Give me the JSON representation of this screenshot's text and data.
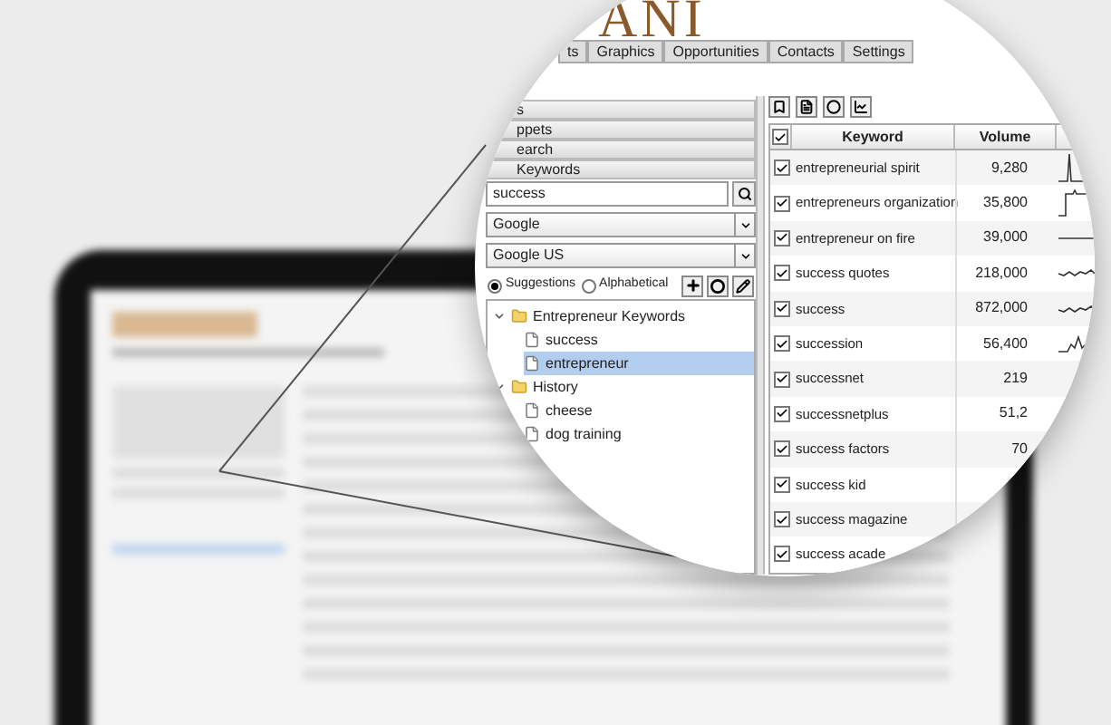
{
  "app": {
    "logo": "ANI",
    "tabs": [
      {
        "label": "ts",
        "selected": false
      },
      {
        "label": "Graphics",
        "selected": false
      },
      {
        "label": "Opportunities",
        "selected": false
      },
      {
        "label": "Contacts",
        "selected": false
      },
      {
        "label": "Settings",
        "selected": false
      }
    ],
    "left_panel": {
      "sections": [
        {
          "label": "s"
        },
        {
          "label": "ppets"
        },
        {
          "label": "earch"
        },
        {
          "label": "Keywords"
        }
      ],
      "search": {
        "value": "success"
      },
      "engine_select": {
        "value": "Google"
      },
      "region_select": {
        "value": "Google US"
      },
      "sort_options": [
        {
          "label": "Suggestions",
          "selected": true
        },
        {
          "label": "Alphabetical",
          "selected": false
        }
      ],
      "tree": [
        {
          "label": "Entrepreneur Keywords",
          "kind": "folder",
          "expanded": true,
          "selected": false,
          "children": [
            {
              "label": "success",
              "kind": "file",
              "selected": false
            },
            {
              "label": "entrepreneur",
              "kind": "file",
              "selected": true
            }
          ]
        },
        {
          "label": "History",
          "kind": "folder",
          "expanded": true,
          "selected": false,
          "children": [
            {
              "label": "cheese",
              "kind": "file",
              "selected": false
            },
            {
              "label": "dog training",
              "kind": "file",
              "selected": false
            }
          ]
        }
      ]
    },
    "table": {
      "columns": [
        "Keyword",
        "Volume"
      ],
      "all_checked": true,
      "rows": [
        {
          "checked": true,
          "keyword": "entrepreneurial spirit",
          "volume": "9,280",
          "kind": "spike"
        },
        {
          "checked": true,
          "keyword": "entrepreneurs organization",
          "volume": "35,800",
          "kind": "step"
        },
        {
          "checked": true,
          "keyword": "entrepreneur on fire",
          "volume": "39,000",
          "kind": "flat"
        },
        {
          "checked": true,
          "keyword": "success quotes",
          "volume": "218,000",
          "kind": "wave"
        },
        {
          "checked": true,
          "keyword": "success",
          "volume": "872,000",
          "kind": "wave"
        },
        {
          "checked": true,
          "keyword": "succession",
          "volume": "56,400",
          "kind": "rise"
        },
        {
          "checked": true,
          "keyword": "successnet",
          "volume": "219"
        },
        {
          "checked": true,
          "keyword": "successnetplus",
          "volume": "51,2"
        },
        {
          "checked": true,
          "keyword": "success factors",
          "volume": "70"
        },
        {
          "checked": true,
          "keyword": "success kid"
        },
        {
          "checked": true,
          "keyword": "success magazine"
        },
        {
          "checked": true,
          "keyword": "success acade"
        }
      ]
    }
  }
}
